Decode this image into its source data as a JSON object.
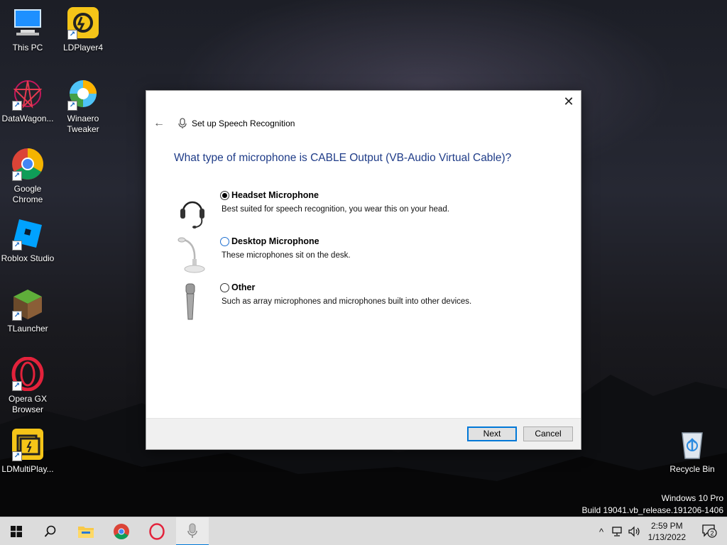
{
  "desktop": {
    "icons": [
      {
        "label": "This PC"
      },
      {
        "label": "LDPlayer4"
      },
      {
        "label": "DataWagon..."
      },
      {
        "label": "Winaero Tweaker"
      },
      {
        "label": "Google Chrome"
      },
      {
        "label": "Roblox Studio"
      },
      {
        "label": "TLauncher"
      },
      {
        "label": "Opera GX Browser"
      },
      {
        "label": "LDMultiPlay..."
      },
      {
        "label": "Recycle Bin"
      }
    ],
    "watermark": {
      "line1": "Windows 10 Pro",
      "line2": "Build 19041.vb_release.191206-1406"
    }
  },
  "dialog": {
    "close_glyph": "✕",
    "back_glyph": "←",
    "title": "Set up Speech Recognition",
    "question": "What type of microphone is CABLE Output (VB-Audio Virtual Cable)?",
    "options": [
      {
        "label": "Headset Microphone",
        "description": "Best suited for speech recognition, you wear this on your head.",
        "selected": true
      },
      {
        "label": "Desktop Microphone",
        "description": "These microphones sit on the desk.",
        "selected": false
      },
      {
        "label": "Other",
        "description": "Such as array microphones and microphones built into other devices.",
        "selected": false
      }
    ],
    "next_label": "Next",
    "cancel_label": "Cancel"
  },
  "taskbar": {
    "clock_time": "2:59 PM",
    "clock_date": "1/13/2022",
    "notification_count": "2",
    "accent": "#0078d7"
  }
}
